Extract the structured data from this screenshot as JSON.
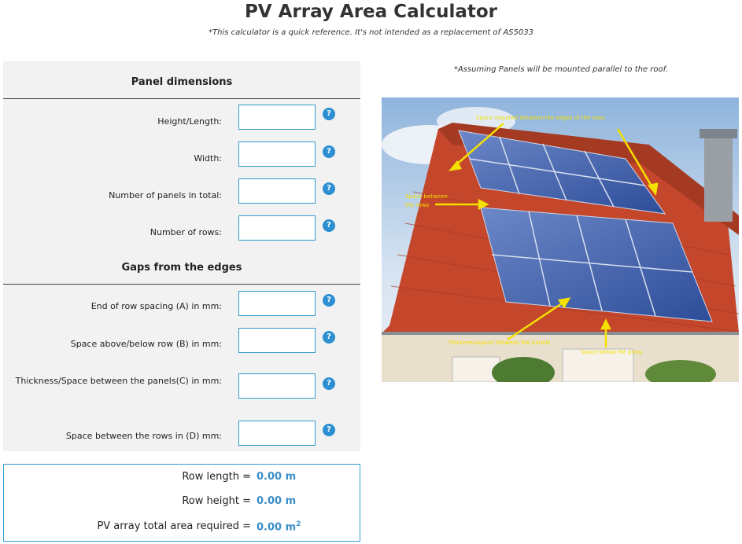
{
  "header": {
    "title": "PV Array Area Calculator",
    "subtitle": "*This calculator is a quick reference. It's not intended as a replacement of AS5033"
  },
  "panel_section": {
    "heading": "Panel dimensions",
    "fields": [
      {
        "label": "Height/Length:",
        "value": ""
      },
      {
        "label": "Width:",
        "value": ""
      },
      {
        "label": "Number of panels in total:",
        "value": ""
      },
      {
        "label": "Number of rows:",
        "value": ""
      }
    ]
  },
  "gaps_section": {
    "heading": "Gaps from the edges",
    "fields": [
      {
        "label": "End of row spacing (A) in mm:",
        "value": ""
      },
      {
        "label": "Space above/below row (B) in mm:",
        "value": ""
      },
      {
        "label": "Thickness/Space between the panels(C) in mm:",
        "value": ""
      },
      {
        "label": "Space between the rows in (D) mm:",
        "value": ""
      }
    ]
  },
  "help_icon_glyph": "?",
  "results": {
    "row_length_label": "Row length =",
    "row_length_value": "0.00 m",
    "row_height_label": "Row height =",
    "row_height_value": "0.00 m",
    "total_area_label": "PV array total area required =",
    "total_area_value": "0.00 m",
    "total_area_exponent": "2"
  },
  "image_note": "*Assuming Panels will be mounted parallel to the roof.",
  "image_annotations": {
    "edges": "Space required between the edges of the rows",
    "rows_line1": "Space between",
    "rows_line2": "the rows",
    "thickness": "Thickness/space between the panels",
    "below": "Space below the array"
  },
  "colors": {
    "accent": "#3399cc",
    "help_icon": "#2c8fd2",
    "result_value": "#3a8fc8",
    "annotation": "#f5e000"
  }
}
